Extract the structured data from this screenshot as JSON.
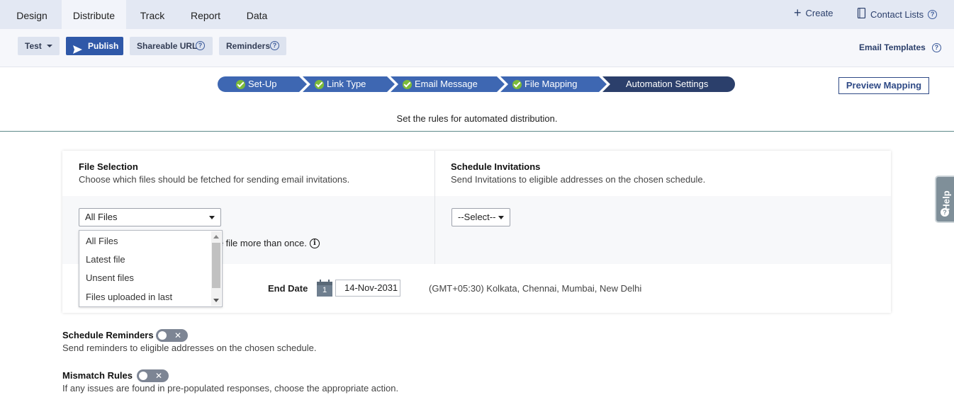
{
  "nav": {
    "tabs": [
      {
        "label": "Design"
      },
      {
        "label": "Distribute"
      },
      {
        "label": "Track"
      },
      {
        "label": "Report"
      },
      {
        "label": "Data"
      }
    ],
    "create_label": "Create",
    "contact_lists_label": "Contact Lists"
  },
  "toolbar": {
    "test_label": "Test",
    "publish_label": "Publish",
    "shareable_url_label": "Shareable URL",
    "reminders_label": "Reminders",
    "email_templates_label": "Email Templates"
  },
  "steps": [
    {
      "label": "Set-Up",
      "done": true
    },
    {
      "label": "Link Type",
      "done": true
    },
    {
      "label": "Email Message",
      "done": true
    },
    {
      "label": "File Mapping",
      "done": true
    },
    {
      "label": "Automation Settings",
      "done": false
    }
  ],
  "preview_mapping_label": "Preview Mapping",
  "subtitle": "Set the rules for automated distribution.",
  "file_selection": {
    "title": "File Selection",
    "description": "Choose which files should be fetched for sending email invitations.",
    "selected": "All Files",
    "options": [
      "All Files",
      "Latest file",
      "Unsent files",
      "Files uploaded in last"
    ],
    "note_visible": "me file more than once."
  },
  "schedule_invitations": {
    "title": "Schedule Invitations",
    "description": "Send Invitations to eligible addresses on the chosen schedule.",
    "selected": "--Select--"
  },
  "end_date": {
    "label": "End Date",
    "calendar_day": "1",
    "value": "14-Nov-2031",
    "timezone": "(GMT+05:30) Kolkata, Chennai, Mumbai, New Delhi"
  },
  "schedule_reminders": {
    "title": "Schedule Reminders",
    "description": "Send reminders to eligible addresses on the chosen schedule.",
    "enabled": false
  },
  "mismatch_rules": {
    "title": "Mismatch Rules",
    "description": "If any issues are found in pre-populated responses, choose the appropriate action.",
    "enabled": false
  },
  "help_label": "Help",
  "colors": {
    "nav_bg": "#e3e8f3",
    "primary": "#2f58a8",
    "step_done": "#3e67b2",
    "step_current": "#2b3f6b",
    "check": "#7dbb3a"
  }
}
